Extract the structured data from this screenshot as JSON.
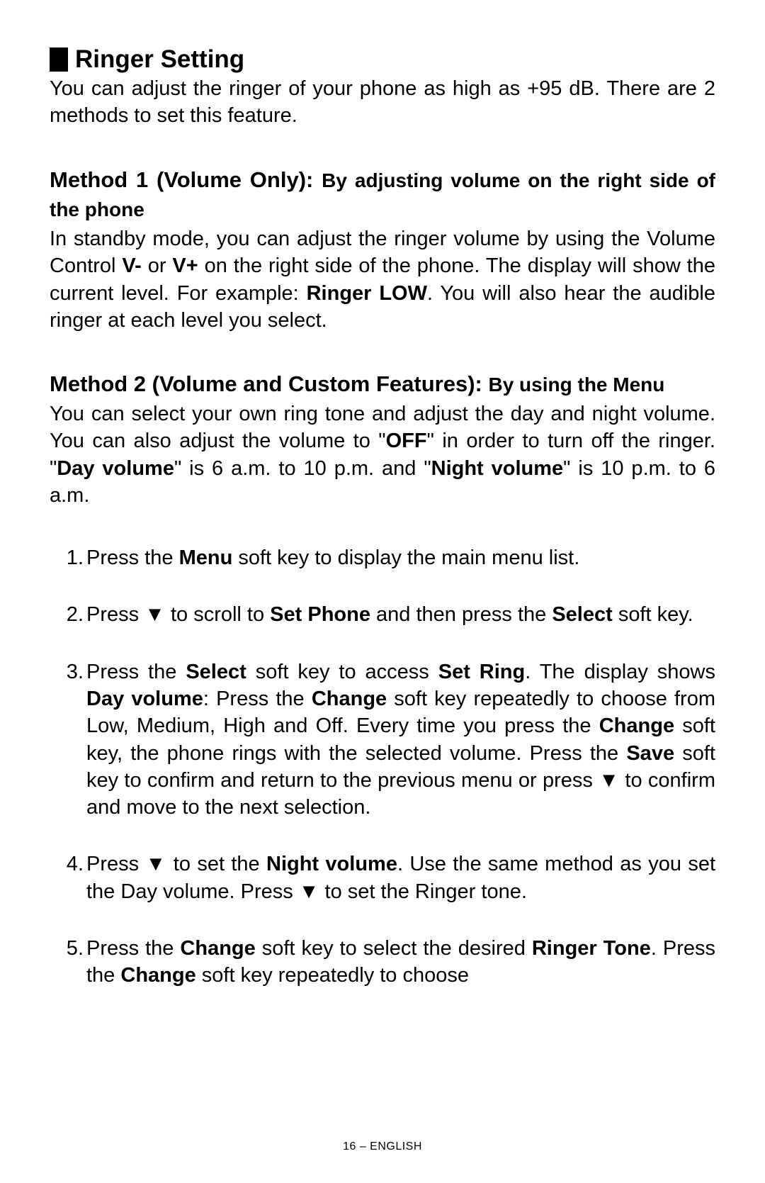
{
  "heading": "Ringer Setting",
  "intro": "You can adjust the ringer of your phone as high as +95 dB. There are 2 methods to set this feature.",
  "method1": {
    "title_main": "Method 1 (Volume Only):",
    "title_sub": "By adjusting volume on the right side of the phone",
    "body_pre": "In standby mode, you can adjust the ringer volume by using the Volume Control ",
    "bold_vminus": "V-",
    "body_mid1": " or ",
    "bold_vplus": "V+",
    "body_mid2": " on the right side of the phone. The display will show the current level. For example: ",
    "bold_ringerlow": "Ringer LOW",
    "body_post": ".  You will also hear the audible ringer at each level you select."
  },
  "method2": {
    "title_main": "Method 2 (Volume and Custom Features):",
    "title_sub": "By using the Menu",
    "body_pre": "You can select your own ring tone and adjust the day and night volume. You can also adjust the volume to \"",
    "bold_off": "OFF",
    "body_mid1": "\" in order to turn off the ringer.  \"",
    "bold_dayvol": "Day volume",
    "body_mid2": "\" is 6 a.m. to 10 p.m. and \"",
    "bold_nightvol": "Night volume",
    "body_post": "\" is 10 p.m. to 6 a.m."
  },
  "steps": {
    "s1": {
      "a": "Press the ",
      "b1": "Menu",
      "c": " soft key to display the main menu list."
    },
    "s2": {
      "a": "Press ▼ to scroll to ",
      "b1": "Set Phone",
      "c": " and then press the ",
      "b2": "Select",
      "d": " soft key."
    },
    "s3": {
      "a": "Press the ",
      "b1": "Select",
      "c": " soft key to access ",
      "b2": "Set Ring",
      "d": ". The display shows ",
      "b3": "Day volume",
      "e": ": Press the ",
      "b4": "Change",
      "f": " soft key repeatedly to choose from Low, Medium, High and Off. Every time you press the ",
      "b5": "Change",
      "g": " soft key, the phone rings with the selected volume. Press the ",
      "b6": "Save",
      "h": " soft key to confirm and return to the previous menu or press ▼ to confirm and move to the next selection."
    },
    "s4": {
      "a": "Press ▼ to set the ",
      "b1": "Night volume",
      "c": ". Use the same method as you set the Day volume. Press ▼ to set the Ringer tone."
    },
    "s5": {
      "a": "Press the ",
      "b1": "Change",
      "c": " soft key to select the desired ",
      "b2": "Ringer Tone",
      "d": ". Press the ",
      "b3": "Change",
      "e": " soft key repeatedly to choose"
    }
  },
  "footer": "16 – ENGLISH"
}
